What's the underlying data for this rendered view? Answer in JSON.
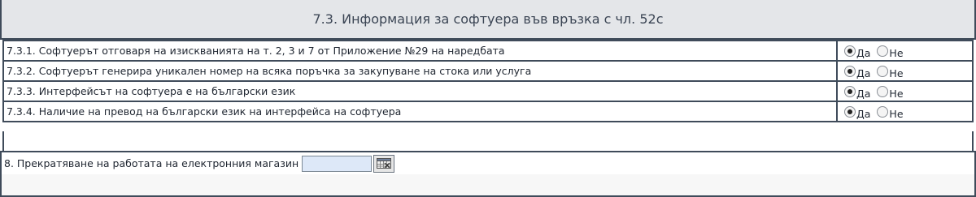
{
  "section": {
    "title": "7.3. Информация за софтуера във връзка с чл. 52с"
  },
  "questions": [
    {
      "label": "7.3.1. Софтуерът отговаря на изискванията на т. 2, 3 и 7 от Приложение №29 на наредбата",
      "yes": "Да",
      "no": "Не",
      "selected": "yes"
    },
    {
      "label": "7.3.2. Софтуерът генерира уникален номер на всяка поръчка за закупуване на стока или услуга",
      "yes": "Да",
      "no": "Не",
      "selected": "yes"
    },
    {
      "label": "7.3.3. Интерфейсът на софтуера е на български език",
      "yes": "Да",
      "no": "Не",
      "selected": "yes"
    },
    {
      "label": "7.3.4. Наличие на превод на български език на интерфейса на софтуера",
      "yes": "Да",
      "no": "Не",
      "selected": "yes"
    }
  ],
  "termination": {
    "label": "8. Прекратяване на работата на електронния магазин",
    "date_value": ""
  },
  "icons": {
    "calendar": "calendar-icon"
  }
}
